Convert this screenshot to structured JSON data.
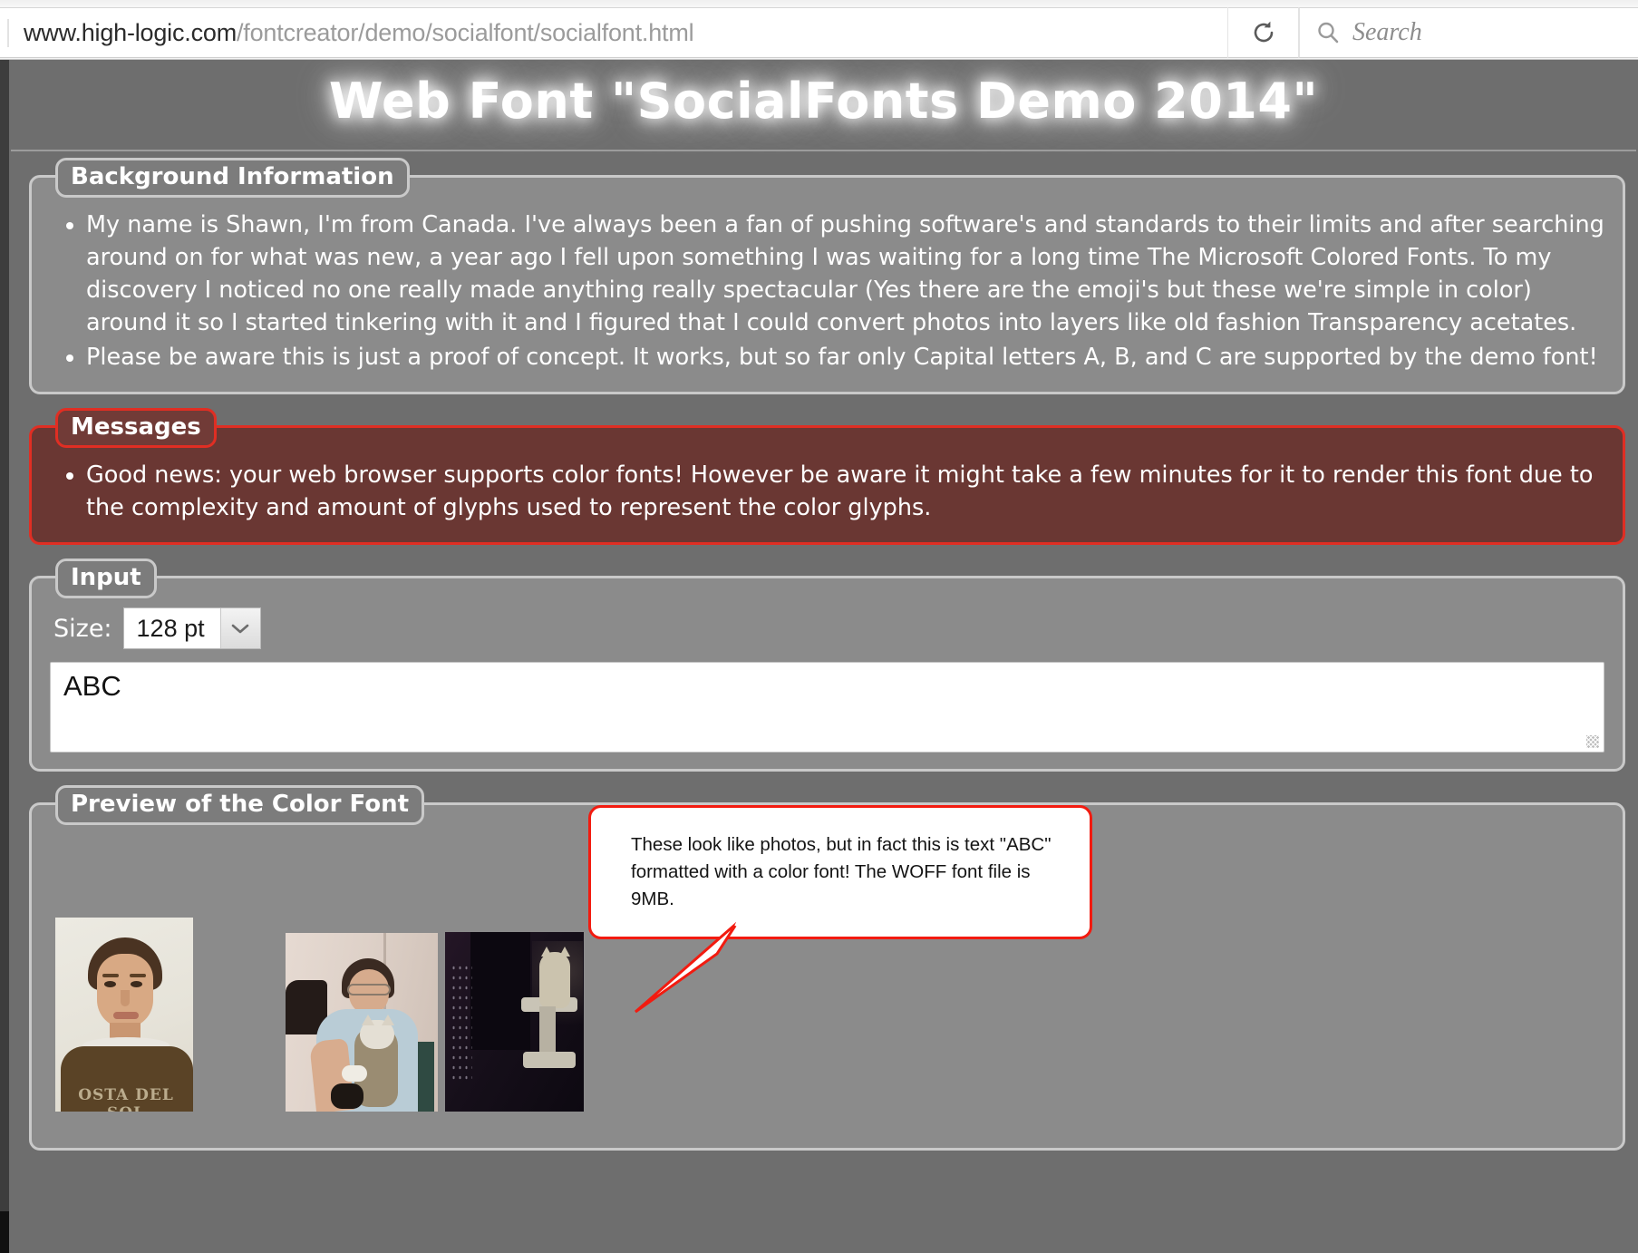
{
  "browser": {
    "url_host": "www.high-logic.com",
    "url_path": "/fontcreator/demo/socialfont/socialfont.html",
    "reload_icon": "reload-icon",
    "search_placeholder": "Search",
    "search_icon": "search-icon",
    "search_value": ""
  },
  "page": {
    "title": "Web Font \"SocialFonts Demo 2014\"",
    "background_color": "#6e6e6e",
    "panel_color": "#8b8b8b",
    "border_color": "#c9c9c9",
    "danger_border_color": "#e02e23",
    "danger_background_color": "#6a3733",
    "callout_border_color": "#f21b10"
  },
  "background_information": {
    "legend": "Background Information",
    "items": [
      "My name is Shawn, I'm from Canada. I've always been a fan of pushing software's and standards to their limits and after searching around on for what was new, a year ago I fell upon something I was waiting for a long time The Microsoft Colored Fonts. To my discovery I noticed no one really made anything really spectacular (Yes there are the emoji's but these we're simple in color) around it so I started tinkering with it and I figured that I could convert photos into layers like old fashion Transparency acetates.",
      "Please be aware this is just a proof of concept. It works, but so far only Capital letters A, B, and C are supported by the demo font!"
    ]
  },
  "messages": {
    "legend": "Messages",
    "items": [
      "Good news: your web browser supports color fonts! However be aware it might take a few minutes for it to render this font due to the complexity and amount of glyphs used to represent the color glyphs."
    ]
  },
  "input": {
    "legend": "Input",
    "size_label": "Size:",
    "size_value": "128 pt",
    "size_options": [
      "128 pt"
    ],
    "dropdown_icon": "chevron-down-icon",
    "text_value": "ABC",
    "text_placeholder": "",
    "resize_handle_icon": "resize-grip-icon"
  },
  "preview": {
    "legend": "Preview of the Color Font",
    "callout_text": "These look like photos, but in fact this is text \"ABC\"\nformatted with a color font! The WOFF font file is 9MB.",
    "glyphs": [
      {
        "letter": "A",
        "caption": "boy-portrait-photo",
        "shirt_text": "OSTA DEL SOL"
      },
      {
        "letter": "B",
        "caption": "woman-with-cat-photo"
      },
      {
        "letter": "C",
        "caption": "cat-on-scratching-post-photo"
      }
    ]
  }
}
